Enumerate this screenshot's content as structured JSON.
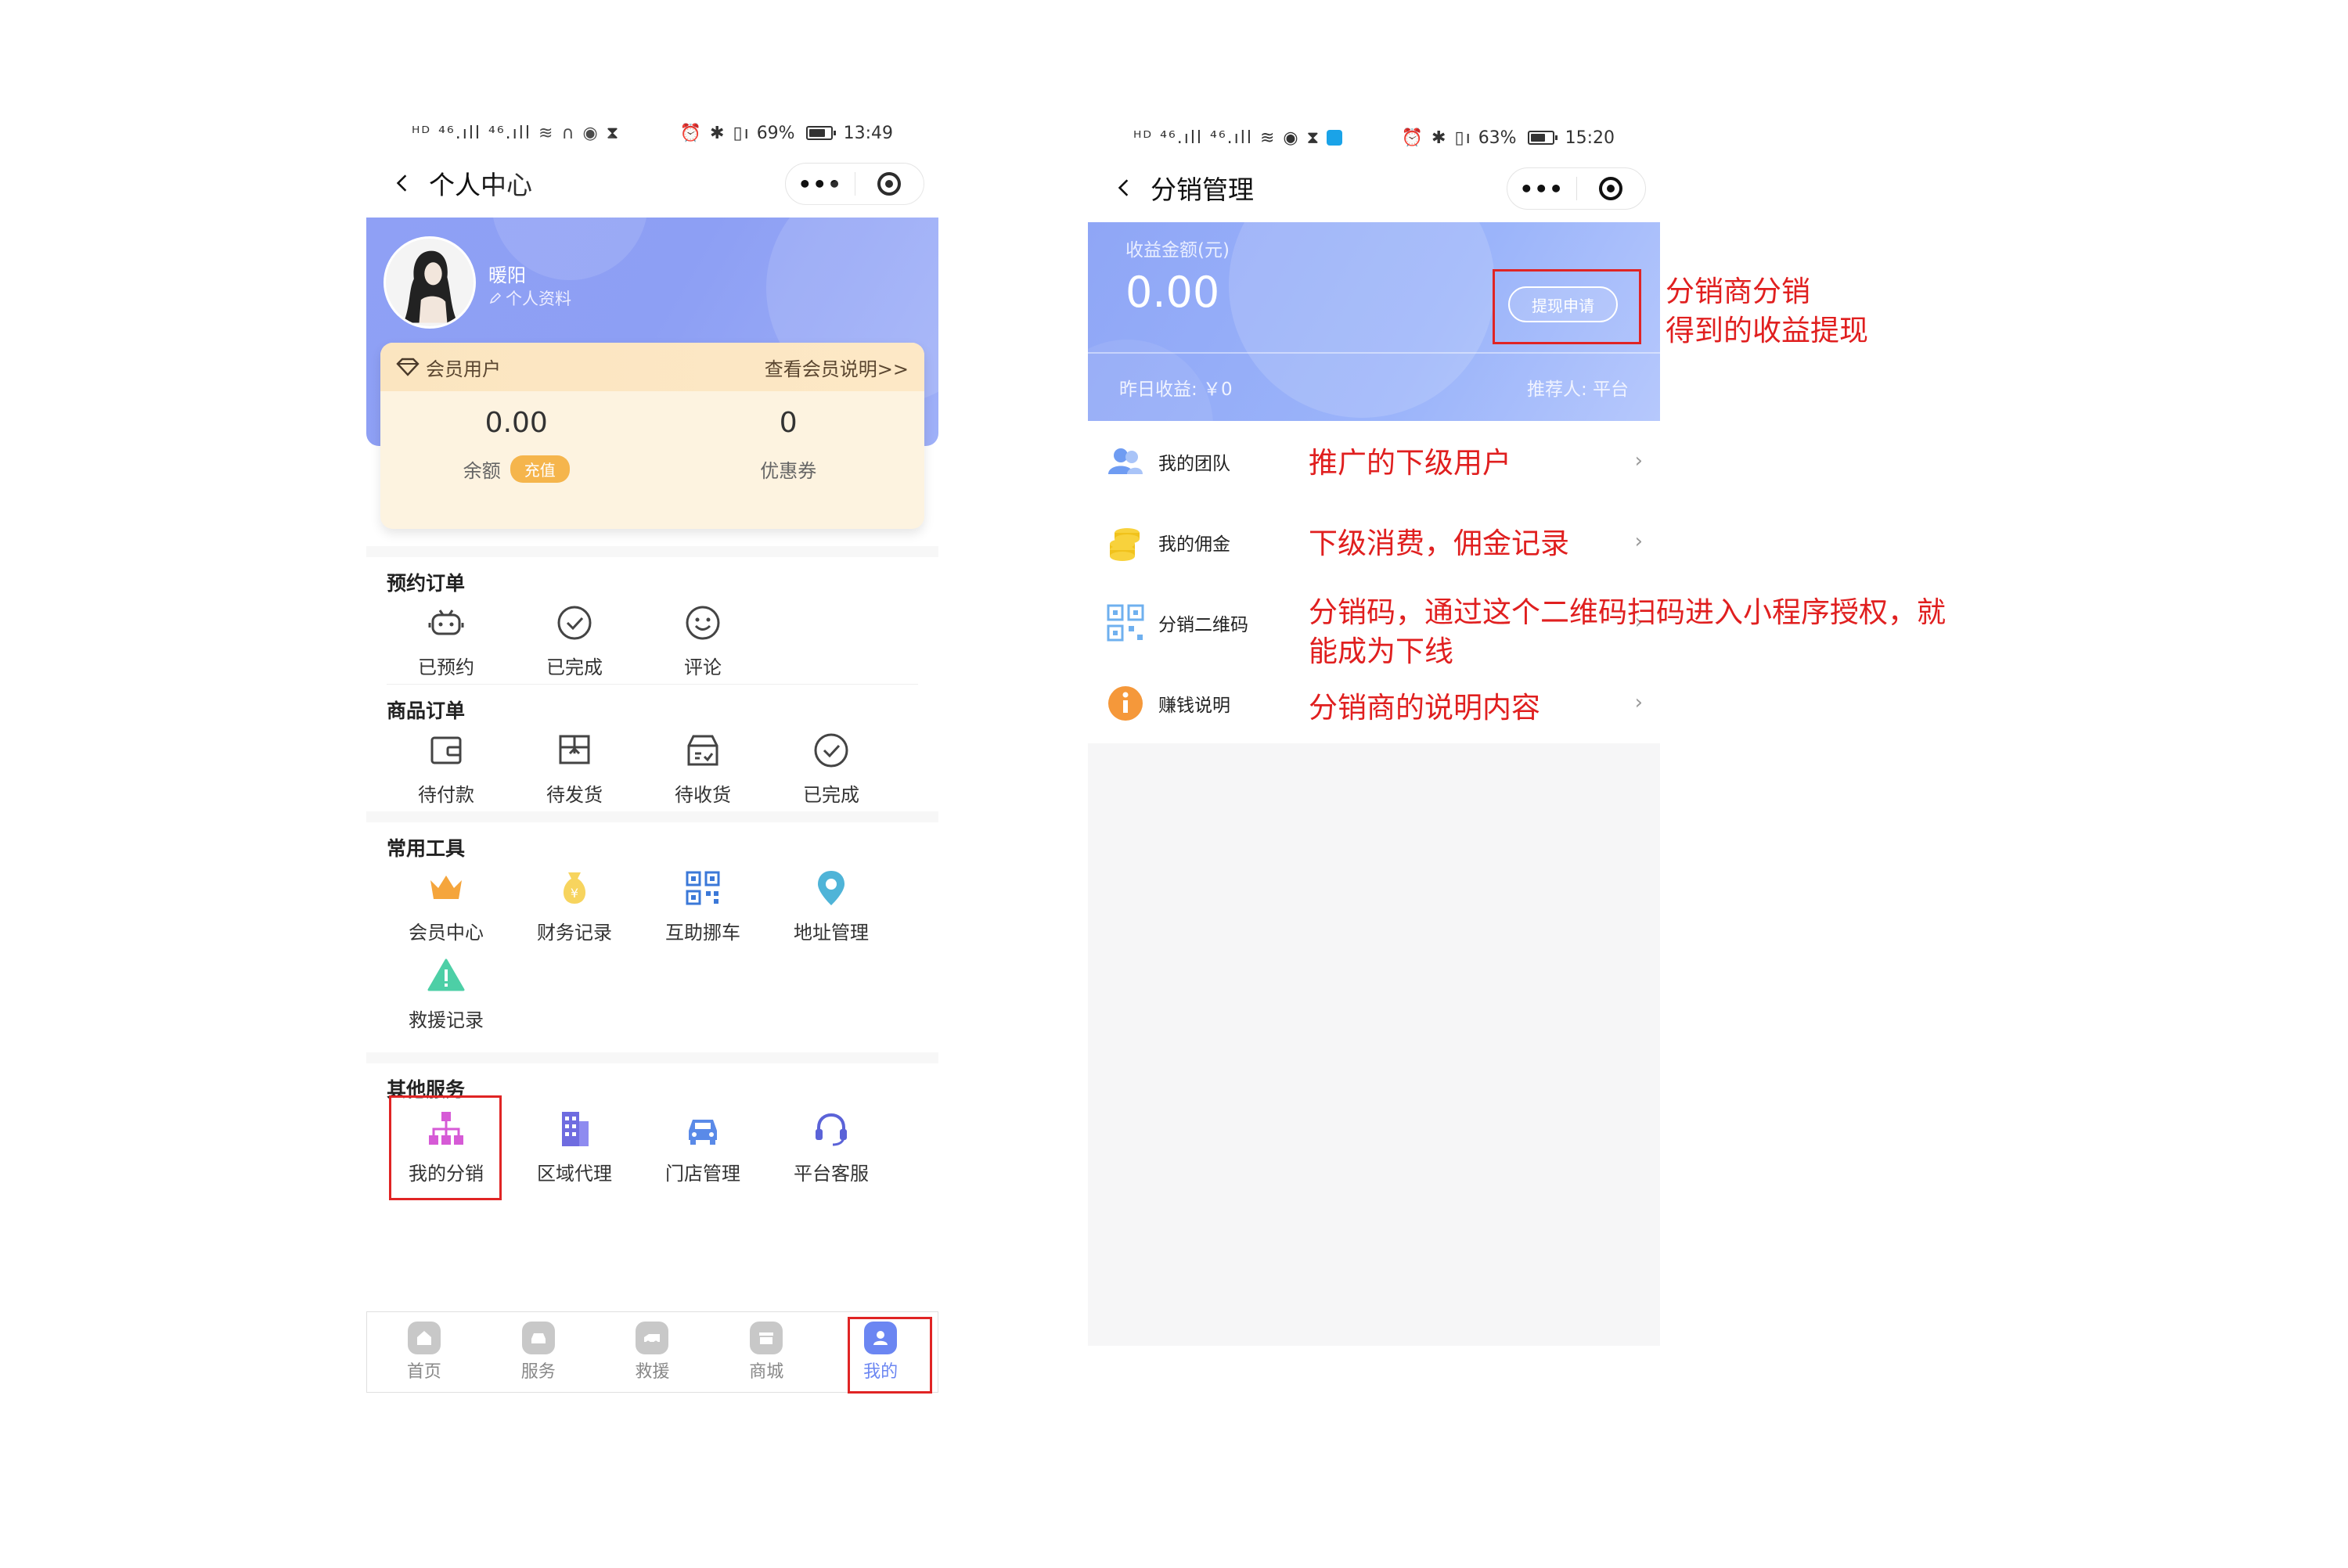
{
  "left": {
    "status": {
      "left_icons": "ᴴᴰ ⁴⁶.ıll ⁴⁶.ıll ≋ ∩ ◉ ⧗",
      "right_icons": "⏰ ✱ ▯ı",
      "battery": "69%",
      "time": "13:49"
    },
    "nav": {
      "title": "个人中心"
    },
    "profile": {
      "username": "暖阳",
      "edit_label": "个人资料"
    },
    "member": {
      "level": "会员用户",
      "link": "查看会员说明>>",
      "balance_value": "0.00",
      "balance_label": "余额",
      "recharge": "充值",
      "coupon_value": "0",
      "coupon_label": "优惠券"
    },
    "booking": {
      "title": "预约订单",
      "items": [
        "已预约",
        "已完成",
        "评论"
      ]
    },
    "goods": {
      "title": "商品订单",
      "items": [
        "待付款",
        "待发货",
        "待收货",
        "已完成"
      ]
    },
    "tools": {
      "title": "常用工具",
      "items": [
        "会员中心",
        "财务记录",
        "互助挪车",
        "地址管理",
        "救援记录"
      ]
    },
    "other": {
      "title": "其他服务",
      "items": [
        "我的分销",
        "区域代理",
        "门店管理",
        "平台客服"
      ]
    },
    "tabs": [
      "首页",
      "服务",
      "救援",
      "商城",
      "我的"
    ]
  },
  "right": {
    "status": {
      "left_icons": "ᴴᴰ ⁴⁶.ıll ⁴⁶.ıll ≋ ◉ ⧗",
      "right_icons": "⏰ ✱ ▯ı",
      "battery": "63%",
      "time": "15:20"
    },
    "nav": {
      "title": "分销管理"
    },
    "earnings": {
      "label": "收益金额(元)",
      "value": "0.00",
      "withdraw": "提现申请",
      "yesterday": "昨日收益: ￥0",
      "referrer": "推荐人: 平台"
    },
    "rows": [
      "我的团队",
      "我的佣金",
      "分销二维码",
      "赚钱说明"
    ]
  },
  "annotations": {
    "withdraw_note_1": "分销商分销",
    "withdraw_note_2": "得到的收益提现",
    "team_note": "推广的下级用户",
    "commission_note": "下级消费，佣金记录",
    "qr_note_1": "分销码，通过这个二维码扫码进入小程序授权，就",
    "qr_note_2": "能成为下线",
    "explain_note": "分销商的说明内容"
  },
  "colors": {
    "accent": "#6b86f2",
    "annotation": "#e01f1f",
    "card_gradient": "#8fa0f5"
  }
}
